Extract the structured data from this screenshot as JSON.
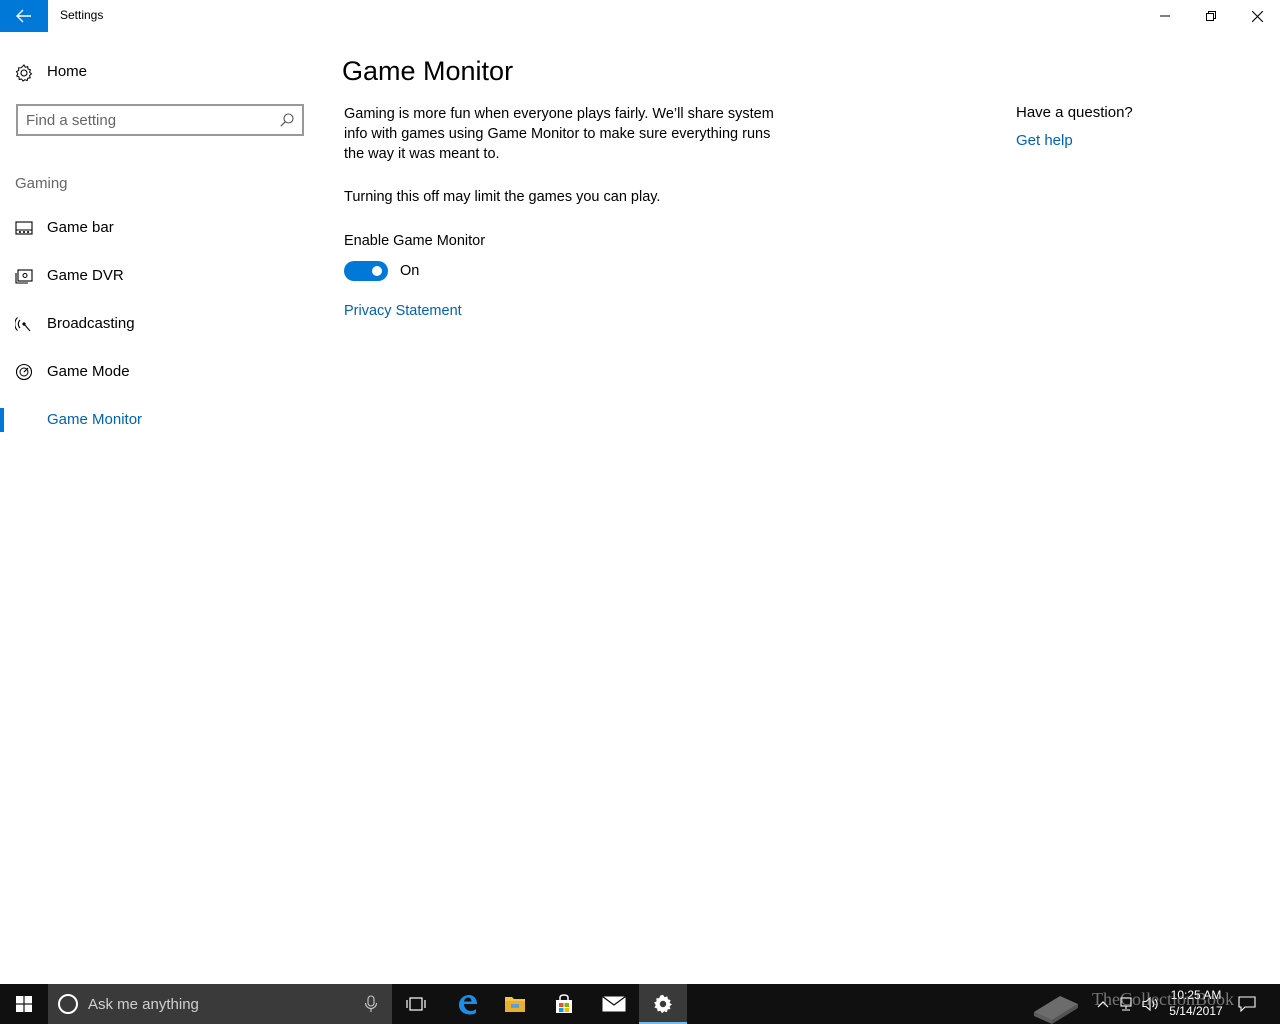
{
  "window": {
    "title": "Settings"
  },
  "sidebar": {
    "home_label": "Home",
    "search_placeholder": "Find a setting",
    "section_label": "Gaming",
    "items": [
      {
        "label": "Game bar",
        "icon": "game-bar-icon"
      },
      {
        "label": "Game DVR",
        "icon": "game-dvr-icon"
      },
      {
        "label": "Broadcasting",
        "icon": "broadcasting-icon"
      },
      {
        "label": "Game Mode",
        "icon": "game-mode-icon"
      },
      {
        "label": "Game Monitor",
        "icon": "game-monitor-icon",
        "active": true
      }
    ]
  },
  "main": {
    "title": "Game Monitor",
    "description": "Gaming is more fun when everyone plays fairly. We’ll share system info with games using Game Monitor to make sure everything runs the way it was meant to.",
    "warning": "Turning this off may limit the games you can play.",
    "toggle_label": "Enable Game Monitor",
    "toggle_on": true,
    "toggle_state": "On",
    "privacy_link": "Privacy Statement"
  },
  "help": {
    "question": "Have a question?",
    "link": "Get help"
  },
  "taskbar": {
    "search_placeholder": "Ask me anything",
    "apps": [
      "task-view-icon",
      "edge-icon",
      "file-explorer-icon",
      "store-icon",
      "mail-icon",
      "settings-icon"
    ],
    "active_app": "settings-icon",
    "clock_time": "10:25 AM",
    "clock_date": "5/14/2017",
    "watermark": "TheCollectionBook"
  },
  "colors": {
    "accent": "#0078d7",
    "link": "#0063b1",
    "taskbar": "#101010"
  }
}
